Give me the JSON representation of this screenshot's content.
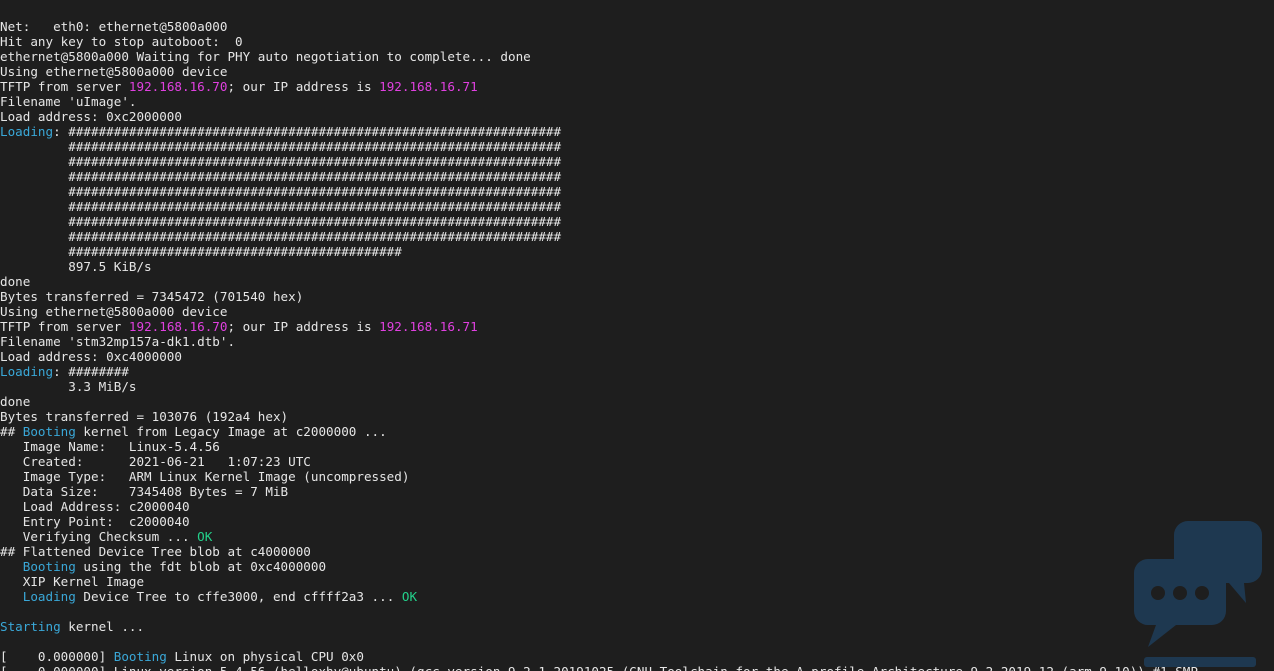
{
  "theme": {
    "background": "#1e1e1e",
    "default": "#e6e6e6",
    "ip": "#e040e0",
    "keyword": "#3aa8d8",
    "ok": "#23d18b",
    "watermark": "#1f4f7a"
  },
  "lines": [
    [
      {
        "t": "Net:   eth0: ethernet@5800a000"
      }
    ],
    [
      {
        "t": "Hit any key to stop autoboot:  0"
      }
    ],
    [
      {
        "t": "ethernet@5800a000 Waiting for PHY auto negotiation to complete... done"
      }
    ],
    [
      {
        "t": "Using ethernet@5800a000 device"
      }
    ],
    [
      {
        "t": "TFTP from server "
      },
      {
        "t": "192.168.16.70",
        "c": "ip"
      },
      {
        "t": "; our IP address is "
      },
      {
        "t": "192.168.16.71",
        "c": "ip"
      }
    ],
    [
      {
        "t": "Filename 'uImage'."
      }
    ],
    [
      {
        "t": "Load address: 0xc2000000"
      }
    ],
    [
      {
        "t": "Loading",
        "c": "keyword"
      },
      {
        "t": ": #################################################################"
      }
    ],
    [
      {
        "t": "         #################################################################"
      }
    ],
    [
      {
        "t": "         #################################################################"
      }
    ],
    [
      {
        "t": "         #################################################################"
      }
    ],
    [
      {
        "t": "         #################################################################"
      }
    ],
    [
      {
        "t": "         #################################################################"
      }
    ],
    [
      {
        "t": "         #################################################################"
      }
    ],
    [
      {
        "t": "         #################################################################"
      }
    ],
    [
      {
        "t": "         ############################################"
      }
    ],
    [
      {
        "t": "         897.5 KiB/s"
      }
    ],
    [
      {
        "t": "done"
      }
    ],
    [
      {
        "t": "Bytes transferred = 7345472 (701540 hex)"
      }
    ],
    [
      {
        "t": "Using ethernet@5800a000 device"
      }
    ],
    [
      {
        "t": "TFTP from server "
      },
      {
        "t": "192.168.16.70",
        "c": "ip"
      },
      {
        "t": "; our IP address is "
      },
      {
        "t": "192.168.16.71",
        "c": "ip"
      }
    ],
    [
      {
        "t": "Filename 'stm32mp157a-dk1.dtb'."
      }
    ],
    [
      {
        "t": "Load address: 0xc4000000"
      }
    ],
    [
      {
        "t": "Loading",
        "c": "keyword"
      },
      {
        "t": ": ########"
      }
    ],
    [
      {
        "t": "         3.3 MiB/s"
      }
    ],
    [
      {
        "t": "done"
      }
    ],
    [
      {
        "t": "Bytes transferred = 103076 (192a4 hex)"
      }
    ],
    [
      {
        "t": "## "
      },
      {
        "t": "Booting",
        "c": "keyword"
      },
      {
        "t": " kernel from Legacy Image at c2000000 ..."
      }
    ],
    [
      {
        "t": "   Image Name:   Linux-5.4.56"
      }
    ],
    [
      {
        "t": "   Created:      2021-06-21   1:07:23 UTC"
      }
    ],
    [
      {
        "t": "   Image Type:   ARM Linux Kernel Image (uncompressed)"
      }
    ],
    [
      {
        "t": "   Data Size:    7345408 Bytes = 7 MiB"
      }
    ],
    [
      {
        "t": "   Load Address: c2000040"
      }
    ],
    [
      {
        "t": "   Entry Point:  c2000040"
      }
    ],
    [
      {
        "t": "   Verifying Checksum ... "
      },
      {
        "t": "OK",
        "c": "ok"
      }
    ],
    [
      {
        "t": "## Flattened Device Tree blob at c4000000"
      }
    ],
    [
      {
        "t": "   "
      },
      {
        "t": "Booting",
        "c": "keyword"
      },
      {
        "t": " using the fdt blob at 0xc4000000"
      }
    ],
    [
      {
        "t": "   XIP Kernel Image"
      }
    ],
    [
      {
        "t": "   "
      },
      {
        "t": "Loading",
        "c": "keyword"
      },
      {
        "t": " Device Tree to cffe3000, end cffff2a3 ... "
      },
      {
        "t": "OK",
        "c": "ok"
      }
    ],
    [
      {
        "t": ""
      }
    ],
    [
      {
        "t": "Starting",
        "c": "keyword"
      },
      {
        "t": " kernel ..."
      }
    ],
    [
      {
        "t": ""
      }
    ],
    [
      {
        "t": "[    0.000000] "
      },
      {
        "t": "Booting",
        "c": "keyword"
      },
      {
        "t": " Linux on physical CPU 0x0"
      }
    ],
    [
      {
        "t": "[    0.000000] Linux version 5.4.56 (helloxhy@ubuntu) (gcc version 9.2.1 20191025 (GNU Toolchain for the A-profile Architecture 9.2-2019.12 (arm-9.10)) #1 SMP"
      }
    ]
  ]
}
